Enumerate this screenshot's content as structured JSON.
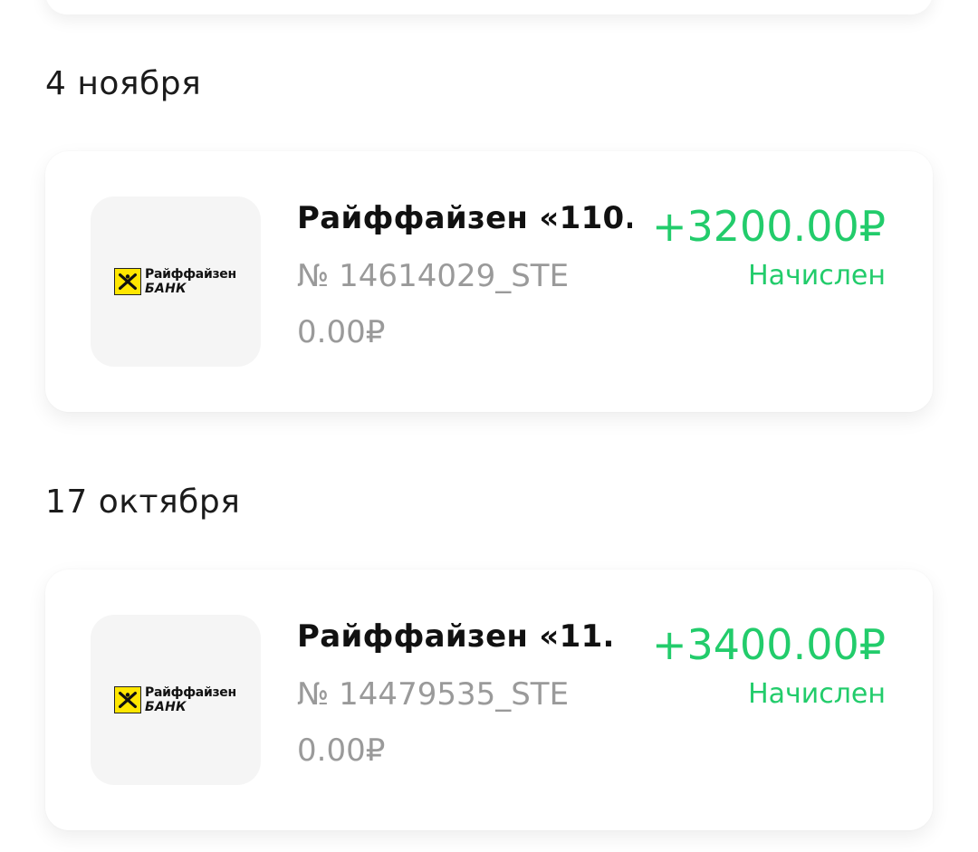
{
  "groups": [
    {
      "date": "4 ноября",
      "transaction": {
        "bank_logo": {
          "icon": "raiffeisen-logo-icon",
          "line1": "Райффайзен",
          "line2": "БАНК",
          "accent": "#ffe600"
        },
        "title": "Райффайзен «110...",
        "number": "№ 14614029_STE",
        "sub_amount": "0.00₽",
        "amount": "+3200.00₽",
        "status": "Начислен"
      }
    },
    {
      "date": "17 октября",
      "transaction": {
        "bank_logo": {
          "icon": "raiffeisen-logo-icon",
          "line1": "Райффайзен",
          "line2": "БАНК",
          "accent": "#ffe600"
        },
        "title": "Райффайзен «11...",
        "number": "№ 14479535_STE",
        "sub_amount": "0.00₽",
        "amount": "+3400.00₽",
        "status": "Начислен"
      }
    }
  ],
  "colors": {
    "accent_green": "#22cc6b",
    "muted_text": "#9a9a9a",
    "title_text": "#111111"
  }
}
